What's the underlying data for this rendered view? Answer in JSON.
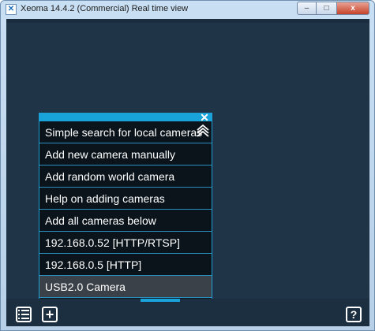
{
  "window": {
    "title": "Xeoma 14.4.2 (Commercial) Real time view",
    "min_glyph": "–",
    "max_glyph": "□",
    "close_glyph": "x"
  },
  "popup": {
    "close_glyph": "✕",
    "items": [
      {
        "label": "Simple search for local cameras"
      },
      {
        "label": "Add new camera manually"
      },
      {
        "label": "Add random world camera"
      },
      {
        "label": "Help on adding cameras"
      },
      {
        "label": "Add all cameras below"
      },
      {
        "label": "192.168.0.52 [HTTP/RTSP]"
      },
      {
        "label": "192.168.0.5 [HTTP]"
      },
      {
        "label": "USB2.0 Camera"
      }
    ]
  },
  "toolbar": {
    "add_glyph": "+",
    "help_glyph": "?"
  },
  "colors": {
    "background": "#1f3447",
    "accent": "#18a3db",
    "menu_bg": "#0b141b",
    "selected_bg": "#3b4148"
  }
}
